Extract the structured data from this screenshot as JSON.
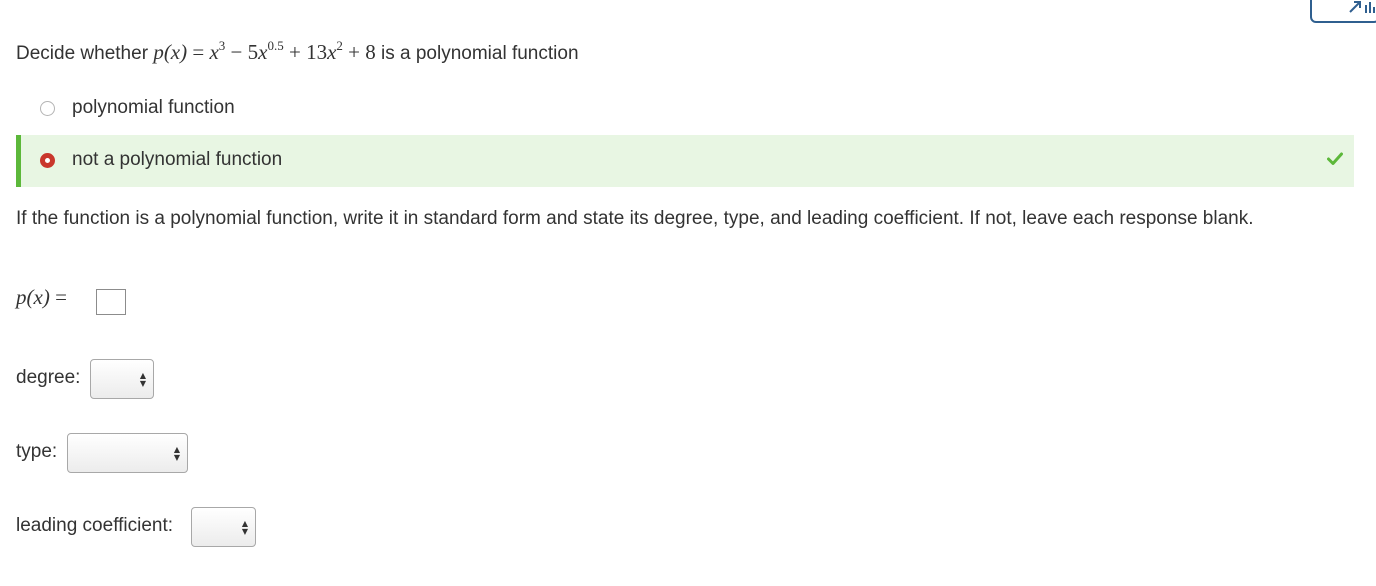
{
  "question": {
    "prefix": "Decide whether",
    "function_lhs": "p(x)",
    "equals": "=",
    "terms": {
      "t1_base": "x",
      "t1_exp": "3",
      "op1": "−",
      "t2_coef": "5",
      "t2_base": "x",
      "t2_exp": "0.5",
      "op2": "+",
      "t3_coef": "13",
      "t3_base": "x",
      "t3_exp": "2",
      "op3": "+",
      "t4": "8"
    },
    "suffix": "is a polynomial function"
  },
  "options": [
    {
      "label": "polynomial function",
      "selected": false
    },
    {
      "label": "not a polynomial function",
      "selected": true,
      "status": "correct"
    }
  ],
  "instructions": "If the function is a polynomial function, write it in standard form and state its degree, type, and leading coefficient. If not, leave each response blank.",
  "standard_form": {
    "lhs": "p(x)",
    "equals": "=",
    "value": ""
  },
  "degree": {
    "label": "degree:",
    "selected": ""
  },
  "type": {
    "label": "type:",
    "selected": ""
  },
  "leading_coefficient": {
    "label": "leading coefficient:",
    "selected": ""
  },
  "colors": {
    "correct_bg": "#e8f6e3",
    "correct_accent": "#5cb83a",
    "radio_selected": "#c9372c",
    "corner_button_border": "#2f5f8f"
  },
  "icons": {
    "corner": "chart-icon",
    "correct": "check-icon"
  }
}
